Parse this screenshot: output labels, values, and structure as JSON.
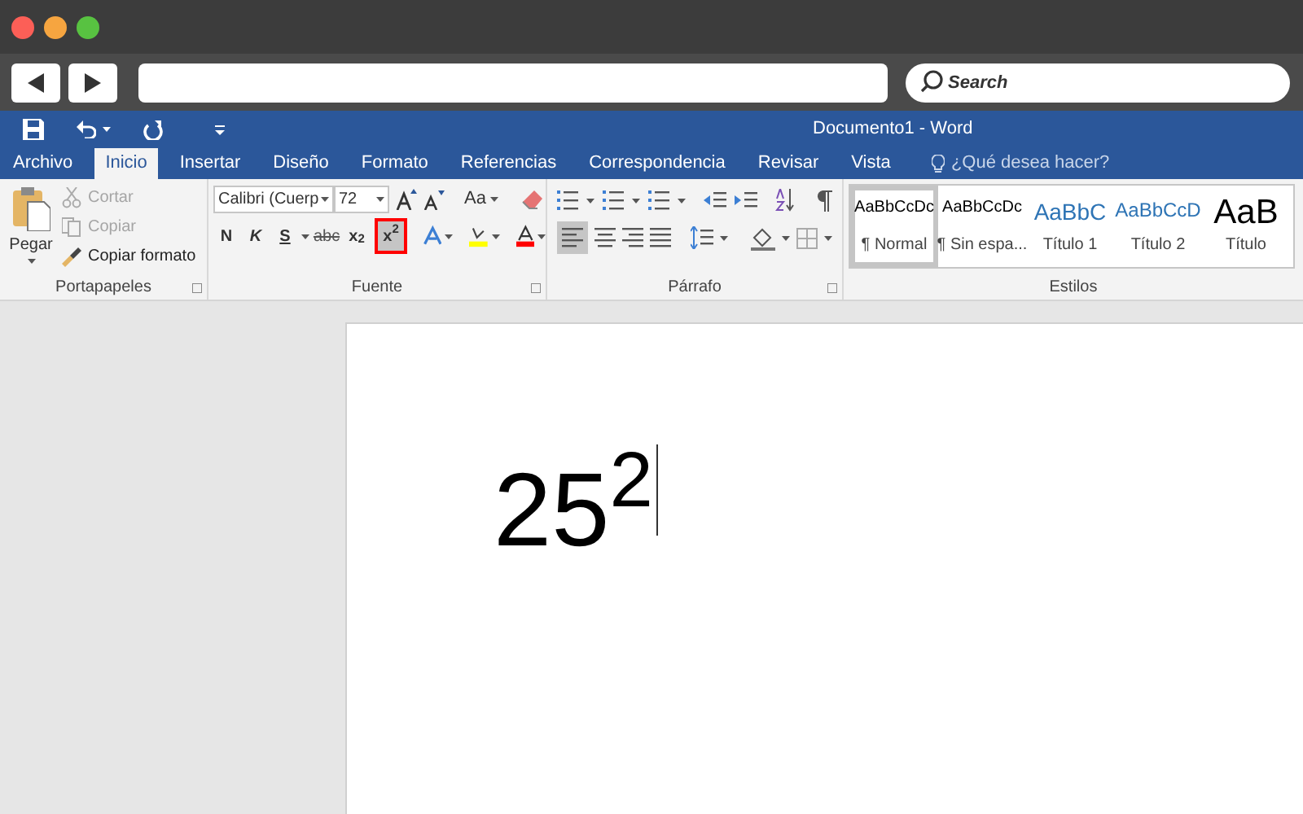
{
  "browser": {
    "search": {
      "placeholder": "Search"
    }
  },
  "word": {
    "title": "Documento1 - Word",
    "tabs": [
      {
        "label": "Archivo",
        "selected": false
      },
      {
        "label": "Inicio",
        "selected": true
      },
      {
        "label": "Insertar",
        "selected": false
      },
      {
        "label": "Diseño",
        "selected": false
      },
      {
        "label": "Formato",
        "selected": false
      },
      {
        "label": "Referencias",
        "selected": false
      },
      {
        "label": "Correspondencia",
        "selected": false
      },
      {
        "label": "Revisar",
        "selected": false
      },
      {
        "label": "Vista",
        "selected": false
      }
    ],
    "tell_me": "¿Qué desea hacer?"
  },
  "clipboard": {
    "paste": "Pegar",
    "items": [
      {
        "label": "Cortar",
        "disabled": true
      },
      {
        "label": "Copiar",
        "disabled": true
      },
      {
        "label": "Copiar formato",
        "disabled": false
      }
    ],
    "group_label": "Portapapeles"
  },
  "font": {
    "font_name": "Calibri (Cuerp",
    "font_size": "72",
    "change_case": "Aa",
    "format_buttons": [
      {
        "label": "N",
        "active": false,
        "highlighted": false
      },
      {
        "label": "K",
        "active": false,
        "highlighted": false
      },
      {
        "label": "S",
        "active": false,
        "highlighted": false
      },
      {
        "label": "abc",
        "active": false,
        "highlighted": false
      },
      {
        "label": "x$_{2}$",
        "active": false,
        "highlighted": false
      },
      {
        "label": "x$^{2}$",
        "active": true,
        "highlighted": true
      }
    ],
    "group_label": "Fuente"
  },
  "paragraph": {
    "group_label": "Párrafo"
  },
  "styles": {
    "items": [
      {
        "preview": "AaBbCcDc",
        "name": "¶ Normal",
        "kind": "normal",
        "selected": true
      },
      {
        "preview": "AaBbCcDc",
        "name": "¶ Sin espa...",
        "kind": "normal",
        "selected": false
      },
      {
        "preview": "AaBbC",
        "name": "Título 1",
        "kind": "heading1",
        "selected": false
      },
      {
        "preview": "AaBbCcD",
        "name": "Título 2",
        "kind": "heading2",
        "selected": false
      },
      {
        "preview": "AaB",
        "name": "Título",
        "kind": "title",
        "selected": false
      }
    ],
    "group_label": "Estilos"
  },
  "document": {
    "text": "25$^{2}$"
  }
}
